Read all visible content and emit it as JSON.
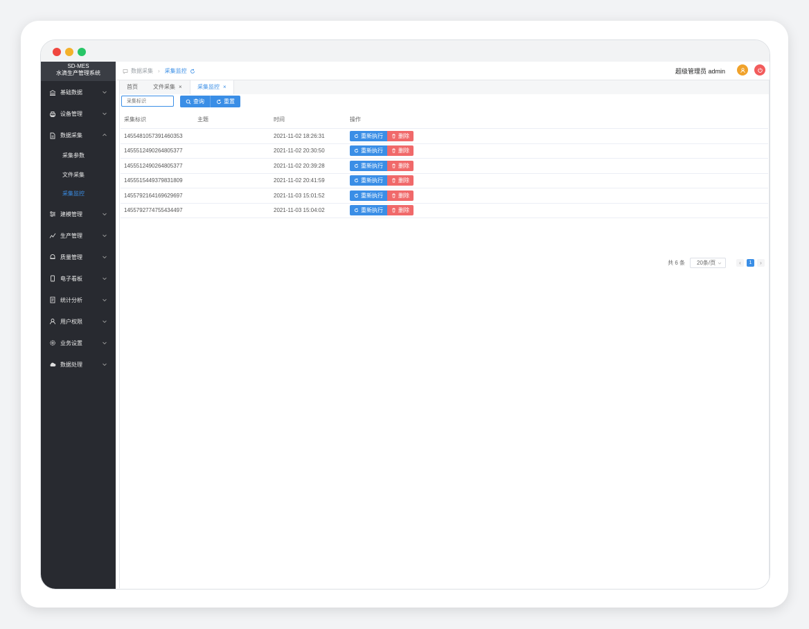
{
  "app": {
    "logo_line1": "SD-MES",
    "logo_line2": "水滴生产管理系统"
  },
  "sidebar": {
    "items": [
      {
        "label": "基础数据",
        "icon": "bank-icon"
      },
      {
        "label": "设备管理",
        "icon": "printer-icon"
      },
      {
        "label": "数据采集",
        "icon": "document-icon",
        "expanded": true
      },
      {
        "label": "建模管理",
        "icon": "sliders-icon"
      },
      {
        "label": "生产管理",
        "icon": "chart-icon"
      },
      {
        "label": "质量管理",
        "icon": "bell-icon"
      },
      {
        "label": "电子看板",
        "icon": "tablet-icon"
      },
      {
        "label": "统计分析",
        "icon": "report-icon"
      },
      {
        "label": "用户权限",
        "icon": "user-icon"
      },
      {
        "label": "业务设置",
        "icon": "gear-icon"
      },
      {
        "label": "数据处理",
        "icon": "cloud-icon"
      }
    ],
    "subitems": [
      {
        "label": "采集参数"
      },
      {
        "label": "文件采集"
      },
      {
        "label": "采集监控",
        "active": true
      }
    ]
  },
  "header": {
    "breadcrumb": [
      "数据采集",
      "采集监控"
    ],
    "user": "超级管理员 admin"
  },
  "tabs": [
    {
      "label": "首页"
    },
    {
      "label": "文件采集",
      "closable": true
    },
    {
      "label": "采集监控",
      "closable": true,
      "active": true
    }
  ],
  "toolbar": {
    "search_placeholder": "采集标识",
    "query_label": "查询",
    "reset_label": "重置"
  },
  "table": {
    "columns": [
      "采集标识",
      "主题",
      "时间",
      "操作"
    ],
    "rows": [
      {
        "id": "1455481057391460353",
        "topic": "",
        "time": "2021-11-02 18:26:31"
      },
      {
        "id": "1455512490264805377",
        "topic": "",
        "time": "2021-11-02 20:30:50"
      },
      {
        "id": "1455512490264805377",
        "topic": "",
        "time": "2021-11-02 20:39:28"
      },
      {
        "id": "1455515449379831809",
        "topic": "",
        "time": "2021-11-02 20:41:59"
      },
      {
        "id": "1455792164169629697",
        "topic": "",
        "time": "2021-11-03 15:01:52"
      },
      {
        "id": "1455792774755434497",
        "topic": "",
        "time": "2021-11-03 15:04:02"
      }
    ],
    "rerun_label": "重新执行",
    "delete_label": "删除"
  },
  "pagination": {
    "total_text": "共 6 条",
    "page_size": "20条/页",
    "current_page": "1"
  },
  "colors": {
    "primary": "#3a8ee6",
    "danger": "#f0696a",
    "sidebar_bg": "#282a30",
    "user_avatar": "#f0a22b",
    "logout": "#f25c5c"
  }
}
